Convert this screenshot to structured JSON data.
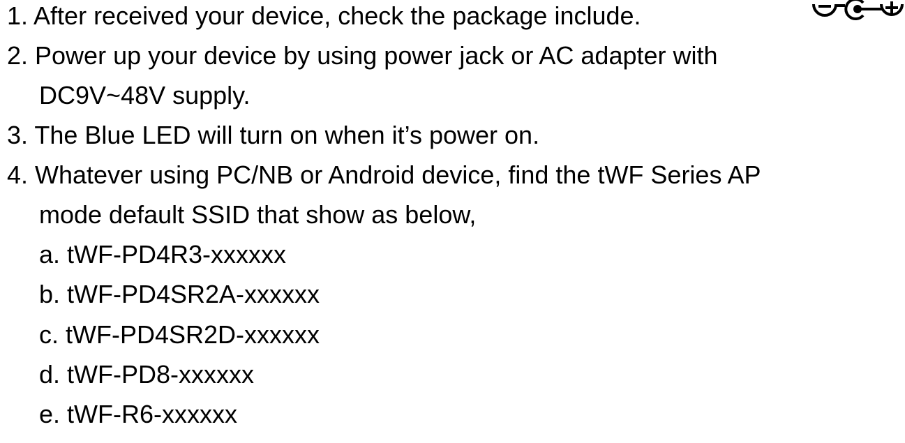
{
  "steps": [
    {
      "text": "1. After received your device, check the package include."
    },
    {
      "text": "2. Power up your device by using power jack or AC adapter with",
      "cont": "DC9V~48V supply."
    },
    {
      "text": "3. The Blue LED will turn on when it’s power on."
    },
    {
      "text": "4. Whatever using PC/NB or Android device, find the tWF Series AP",
      "cont": "mode default SSID that show as below,"
    }
  ],
  "ssids": [
    "a. tWF-PD4R3-xxxxxx",
    "b. tWF-PD4SR2A-xxxxxx",
    "c. tWF-PD4SR2D-xxxxxx",
    "d. tWF-PD8-xxxxxx",
    "e. tWF-R6-xxxxxx"
  ],
  "icons": {
    "polarity": "dc-polarity-center-positive-icon",
    "color": "#000000"
  }
}
